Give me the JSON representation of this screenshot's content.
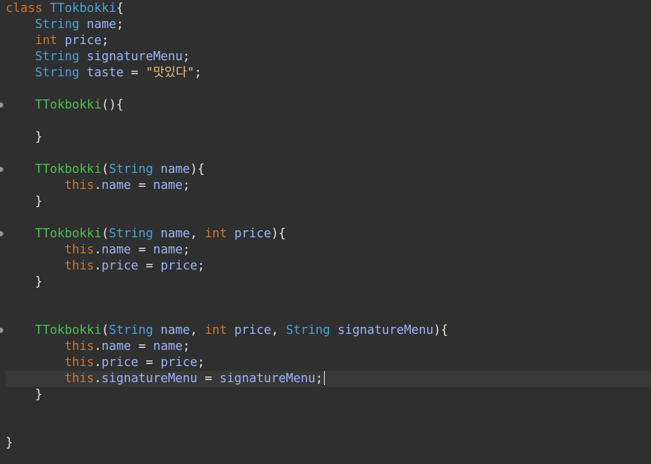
{
  "editor": {
    "language": "java",
    "cursor": {
      "line": 24,
      "after": "this.signatureMenu = signatureMenu;"
    },
    "colors": {
      "background": "#2f2f2f",
      "keyword": "#cc7832",
      "type": "#4aa3d8",
      "constructor": "#4cbf50",
      "identifier": "#9ab7f7",
      "string": "#e6c07b",
      "current_line": "#383838"
    },
    "lines": [
      {
        "n": 1,
        "tokens": [
          [
            "kw",
            "class"
          ],
          [
            "sp",
            " "
          ],
          [
            "cls",
            "TTokbokki"
          ],
          [
            "punct",
            "{"
          ]
        ]
      },
      {
        "n": 2,
        "tokens": [
          [
            "sp",
            "    "
          ],
          [
            "type",
            "String"
          ],
          [
            "sp",
            " "
          ],
          [
            "ident",
            "name"
          ],
          [
            "punct",
            ";"
          ]
        ]
      },
      {
        "n": 3,
        "tokens": [
          [
            "sp",
            "    "
          ],
          [
            "kw",
            "int"
          ],
          [
            "sp",
            " "
          ],
          [
            "ident",
            "price"
          ],
          [
            "punct",
            ";"
          ]
        ]
      },
      {
        "n": 4,
        "tokens": [
          [
            "sp",
            "    "
          ],
          [
            "type",
            "String"
          ],
          [
            "sp",
            " "
          ],
          [
            "ident",
            "signatureMenu"
          ],
          [
            "punct",
            ";"
          ]
        ]
      },
      {
        "n": 5,
        "tokens": [
          [
            "sp",
            "    "
          ],
          [
            "type",
            "String"
          ],
          [
            "sp",
            " "
          ],
          [
            "ident",
            "taste"
          ],
          [
            "sp",
            " "
          ],
          [
            "op",
            "="
          ],
          [
            "sp",
            " "
          ],
          [
            "str",
            "\"맛있다\""
          ],
          [
            "punct",
            ";"
          ]
        ]
      },
      {
        "n": 6,
        "tokens": []
      },
      {
        "n": 7,
        "fold": true,
        "tokens": [
          [
            "sp",
            "    "
          ],
          [
            "ctor",
            "TTokbokki"
          ],
          [
            "punct",
            "(){"
          ]
        ]
      },
      {
        "n": 8,
        "tokens": []
      },
      {
        "n": 9,
        "tokens": [
          [
            "sp",
            "    "
          ],
          [
            "punct",
            "}"
          ]
        ]
      },
      {
        "n": 10,
        "tokens": []
      },
      {
        "n": 11,
        "fold": true,
        "tokens": [
          [
            "sp",
            "    "
          ],
          [
            "ctor",
            "TTokbokki"
          ],
          [
            "punct",
            "("
          ],
          [
            "type",
            "String"
          ],
          [
            "sp",
            " "
          ],
          [
            "ident",
            "name"
          ],
          [
            "punct",
            "){"
          ]
        ]
      },
      {
        "n": 12,
        "tokens": [
          [
            "sp",
            "        "
          ],
          [
            "kw",
            "this"
          ],
          [
            "punct",
            "."
          ],
          [
            "ident",
            "name"
          ],
          [
            "sp",
            " "
          ],
          [
            "op",
            "="
          ],
          [
            "sp",
            " "
          ],
          [
            "ident",
            "name"
          ],
          [
            "punct",
            ";"
          ]
        ]
      },
      {
        "n": 13,
        "tokens": [
          [
            "sp",
            "    "
          ],
          [
            "punct",
            "}"
          ]
        ]
      },
      {
        "n": 14,
        "tokens": []
      },
      {
        "n": 15,
        "fold": true,
        "tokens": [
          [
            "sp",
            "    "
          ],
          [
            "ctor",
            "TTokbokki"
          ],
          [
            "punct",
            "("
          ],
          [
            "type",
            "String"
          ],
          [
            "sp",
            " "
          ],
          [
            "ident",
            "name"
          ],
          [
            "punct",
            ","
          ],
          [
            "sp",
            " "
          ],
          [
            "kw",
            "int"
          ],
          [
            "sp",
            " "
          ],
          [
            "ident",
            "price"
          ],
          [
            "punct",
            "){"
          ]
        ]
      },
      {
        "n": 16,
        "tokens": [
          [
            "sp",
            "        "
          ],
          [
            "kw",
            "this"
          ],
          [
            "punct",
            "."
          ],
          [
            "ident",
            "name"
          ],
          [
            "sp",
            " "
          ],
          [
            "op",
            "="
          ],
          [
            "sp",
            " "
          ],
          [
            "ident",
            "name"
          ],
          [
            "punct",
            ";"
          ]
        ]
      },
      {
        "n": 17,
        "tokens": [
          [
            "sp",
            "        "
          ],
          [
            "kw",
            "this"
          ],
          [
            "punct",
            "."
          ],
          [
            "ident",
            "price"
          ],
          [
            "sp",
            " "
          ],
          [
            "op",
            "="
          ],
          [
            "sp",
            " "
          ],
          [
            "ident",
            "price"
          ],
          [
            "punct",
            ";"
          ]
        ]
      },
      {
        "n": 18,
        "tokens": [
          [
            "sp",
            "    "
          ],
          [
            "punct",
            "}"
          ]
        ]
      },
      {
        "n": 19,
        "tokens": []
      },
      {
        "n": 20,
        "tokens": []
      },
      {
        "n": 21,
        "fold": true,
        "tokens": [
          [
            "sp",
            "    "
          ],
          [
            "ctor",
            "TTokbokki"
          ],
          [
            "punct",
            "("
          ],
          [
            "type",
            "String"
          ],
          [
            "sp",
            " "
          ],
          [
            "ident",
            "name"
          ],
          [
            "punct",
            ","
          ],
          [
            "sp",
            " "
          ],
          [
            "kw",
            "int"
          ],
          [
            "sp",
            " "
          ],
          [
            "ident",
            "price"
          ],
          [
            "punct",
            ","
          ],
          [
            "sp",
            " "
          ],
          [
            "type",
            "String"
          ],
          [
            "sp",
            " "
          ],
          [
            "ident",
            "signatureMenu"
          ],
          [
            "punct",
            "){"
          ]
        ]
      },
      {
        "n": 22,
        "tokens": [
          [
            "sp",
            "        "
          ],
          [
            "kw",
            "this"
          ],
          [
            "punct",
            "."
          ],
          [
            "ident",
            "name"
          ],
          [
            "sp",
            " "
          ],
          [
            "op",
            "="
          ],
          [
            "sp",
            " "
          ],
          [
            "ident",
            "name"
          ],
          [
            "punct",
            ";"
          ]
        ]
      },
      {
        "n": 23,
        "tokens": [
          [
            "sp",
            "        "
          ],
          [
            "kw",
            "this"
          ],
          [
            "punct",
            "."
          ],
          [
            "ident",
            "price"
          ],
          [
            "sp",
            " "
          ],
          [
            "op",
            "="
          ],
          [
            "sp",
            " "
          ],
          [
            "ident",
            "price"
          ],
          [
            "punct",
            ";"
          ]
        ]
      },
      {
        "n": 24,
        "current": true,
        "tokens": [
          [
            "sp",
            "        "
          ],
          [
            "kw",
            "this"
          ],
          [
            "punct",
            "."
          ],
          [
            "ident",
            "signatureMenu"
          ],
          [
            "sp",
            " "
          ],
          [
            "op",
            "="
          ],
          [
            "sp",
            " "
          ],
          [
            "ident",
            "signatureMenu"
          ],
          [
            "punct",
            ";"
          ]
        ]
      },
      {
        "n": 25,
        "tokens": [
          [
            "sp",
            "    "
          ],
          [
            "punct",
            "}"
          ]
        ]
      },
      {
        "n": 26,
        "tokens": []
      },
      {
        "n": 27,
        "tokens": []
      },
      {
        "n": 28,
        "tokens": [
          [
            "punct",
            "}"
          ]
        ]
      }
    ]
  }
}
